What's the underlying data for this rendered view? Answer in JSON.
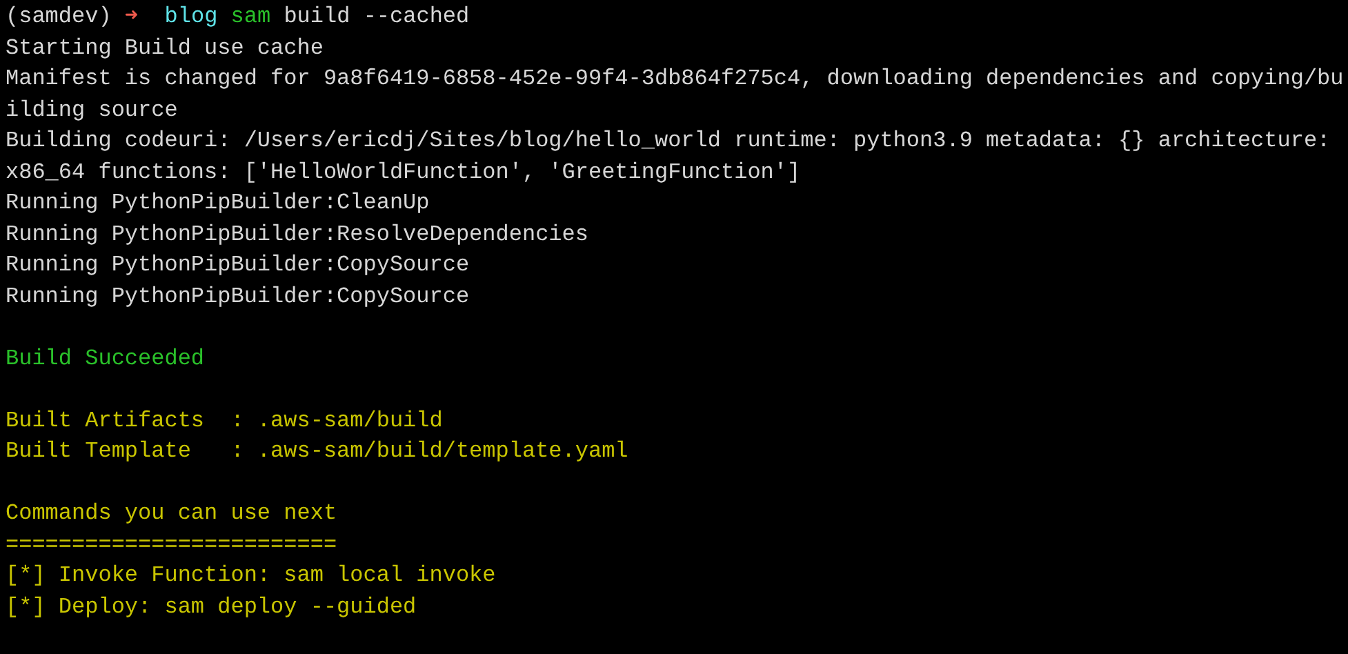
{
  "terminal": {
    "lines": [
      {
        "kind": "prompt",
        "env": "(samdev)",
        "arrow": "➜",
        "dir": "blog",
        "command": "sam",
        "args": "build --cached"
      },
      {
        "kind": "output",
        "color": "#d6d6d6",
        "text": "Starting Build use cache"
      },
      {
        "kind": "output",
        "color": "#d6d6d6",
        "text": "Manifest is changed for 9a8f6419-6858-452e-99f4-3db864f275c4, downloading dependencies and copying/bu"
      },
      {
        "kind": "output",
        "color": "#d6d6d6",
        "text": "ilding source"
      },
      {
        "kind": "output",
        "color": "#d6d6d6",
        "text": "Building codeuri: /Users/ericdj/Sites/blog/hello_world runtime: python3.9 metadata: {} architecture:"
      },
      {
        "kind": "output",
        "color": "#d6d6d6",
        "text": "x86_64 functions: ['HelloWorldFunction', 'GreetingFunction']"
      },
      {
        "kind": "output",
        "color": "#d6d6d6",
        "text": "Running PythonPipBuilder:CleanUp"
      },
      {
        "kind": "output",
        "color": "#d6d6d6",
        "text": "Running PythonPipBuilder:ResolveDependencies"
      },
      {
        "kind": "output",
        "color": "#d6d6d6",
        "text": "Running PythonPipBuilder:CopySource"
      },
      {
        "kind": "output",
        "color": "#d6d6d6",
        "text": "Running PythonPipBuilder:CopySource"
      },
      {
        "kind": "blank"
      },
      {
        "kind": "output",
        "color": "#2ac12a",
        "text": "Build Succeeded"
      },
      {
        "kind": "blank"
      },
      {
        "kind": "output",
        "color": "#c9c500",
        "text": "Built Artifacts  : .aws-sam/build"
      },
      {
        "kind": "output",
        "color": "#c9c500",
        "text": "Built Template   : .aws-sam/build/template.yaml"
      },
      {
        "kind": "blank"
      },
      {
        "kind": "output",
        "color": "#c9c500",
        "text": "Commands you can use next"
      },
      {
        "kind": "output",
        "color": "#c9c500",
        "text": "========================="
      },
      {
        "kind": "output",
        "color": "#c9c500",
        "text": "[*] Invoke Function: sam local invoke"
      },
      {
        "kind": "output",
        "color": "#c9c500",
        "text": "[*] Deploy: sam deploy --guided"
      }
    ]
  }
}
